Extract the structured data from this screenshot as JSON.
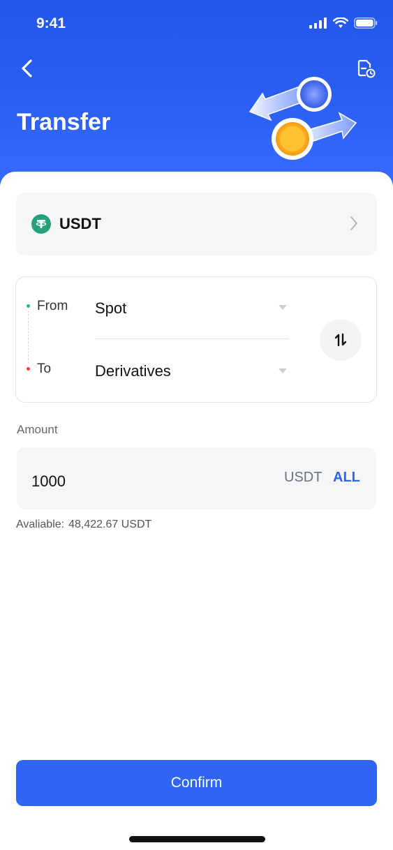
{
  "status_bar": {
    "time": "9:41"
  },
  "header": {
    "title": "Transfer"
  },
  "coin": {
    "name": "USDT"
  },
  "transfer": {
    "from_label": "From",
    "from_value": "Spot",
    "to_label": "To",
    "to_value": "Derivatives"
  },
  "amount": {
    "label": "Amount",
    "value": "1000",
    "unit": "USDT",
    "all_label": "ALL"
  },
  "available": {
    "label": "Avaliable:",
    "value": "48,422.67 USDT"
  },
  "confirm": {
    "label": "Confirm"
  },
  "colors": {
    "brand": "#2f66f6",
    "header_bg": "#2156ea",
    "tether": "#26a17b",
    "from_dot": "#1fbf75",
    "to_dot": "#ef4444"
  }
}
